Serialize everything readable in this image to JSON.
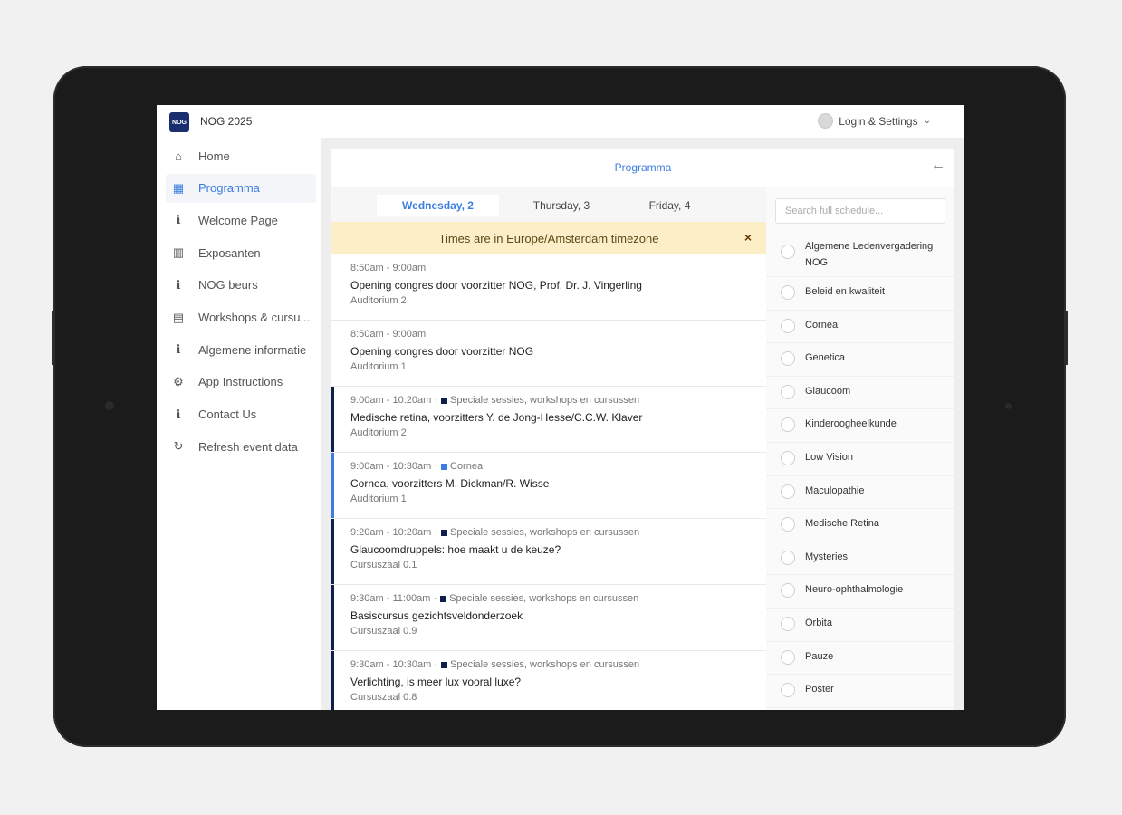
{
  "app": {
    "logo_text": "NOG",
    "title": "NOG 2025",
    "login_label": "Login & Settings"
  },
  "sidebar": {
    "items": [
      {
        "label": "Home",
        "icon": "home-icon",
        "glyph": "⌂"
      },
      {
        "label": "Programma",
        "icon": "calendar-icon",
        "glyph": "▦"
      },
      {
        "label": "Welcome Page",
        "icon": "info-icon",
        "glyph": "ℹ"
      },
      {
        "label": "Exposanten",
        "icon": "building-icon",
        "glyph": "▥"
      },
      {
        "label": "NOG beurs",
        "icon": "info-icon",
        "glyph": "ℹ"
      },
      {
        "label": "Workshops & cursu...",
        "icon": "calendar-icon",
        "glyph": "▤"
      },
      {
        "label": "Algemene informatie",
        "icon": "info-icon",
        "glyph": "ℹ"
      },
      {
        "label": "App Instructions",
        "icon": "cogs-icon",
        "glyph": "⚙"
      },
      {
        "label": "Contact Us",
        "icon": "info-icon",
        "glyph": "ℹ"
      },
      {
        "label": "Refresh event data",
        "icon": "refresh-icon",
        "glyph": "↻"
      }
    ]
  },
  "panel": {
    "title": "Programma",
    "back_glyph": "←"
  },
  "tabs": [
    {
      "label": "Wednesday, 2"
    },
    {
      "label": "Thursday, 3"
    },
    {
      "label": "Friday, 4"
    }
  ],
  "timezone_banner": {
    "text": "Times are in Europe/Amsterdam timezone",
    "close": "×"
  },
  "colors": {
    "accent": "#3b7de0",
    "navy": "#0f1f4d",
    "cornea": "#3b7de0",
    "banner": "#fcefc7"
  },
  "events": [
    {
      "time": "8:50am - 9:00am",
      "tag": "",
      "title": "Opening congres door voorzitter NOG, Prof. Dr. J. Vingerling",
      "room": "Auditorium 2"
    },
    {
      "time": "8:50am - 9:00am",
      "tag": "",
      "title": "Opening congres door voorzitter NOG",
      "room": "Auditorium 1"
    },
    {
      "time": "9:00am - 10:20am ·",
      "tag": "Speciale sessies, workshops en cursussen",
      "title": "Medische retina, voorzitters Y. de Jong-Hesse/C.C.W. Klaver",
      "room": "Auditorium 2"
    },
    {
      "time": "9:00am - 10:30am ·",
      "tag": "Cornea",
      "title": "Cornea, voorzitters M. Dickman/R. Wisse",
      "room": "Auditorium 1"
    },
    {
      "time": "9:20am - 10:20am ·",
      "tag": "Speciale sessies, workshops en cursussen",
      "title": "Glaucoomdruppels: hoe maakt u de keuze?",
      "room": "Cursuszaal 0.1"
    },
    {
      "time": "9:30am - 11:00am ·",
      "tag": "Speciale sessies, workshops en cursussen",
      "title": "Basiscursus gezichtsveldonderzoek",
      "room": "Cursuszaal 0.9"
    },
    {
      "time": "9:30am - 10:30am ·",
      "tag": "Speciale sessies, workshops en cursussen",
      "title": "Verlichting, is meer lux vooral luxe?",
      "room": "Cursuszaal 0.8"
    }
  ],
  "search": {
    "placeholder": "Search full schedule..."
  },
  "filters": [
    "Algemene Ledenvergadering NOG",
    "Beleid en kwaliteit",
    "Cornea",
    "Genetica",
    "Glaucoom",
    "Kinderoogheelkunde",
    "Low Vision",
    "Maculopathie",
    "Medische Retina",
    "Mysteries",
    "Neuro-ophthalmologie",
    "Orbita",
    "Pauze",
    "Poster"
  ]
}
